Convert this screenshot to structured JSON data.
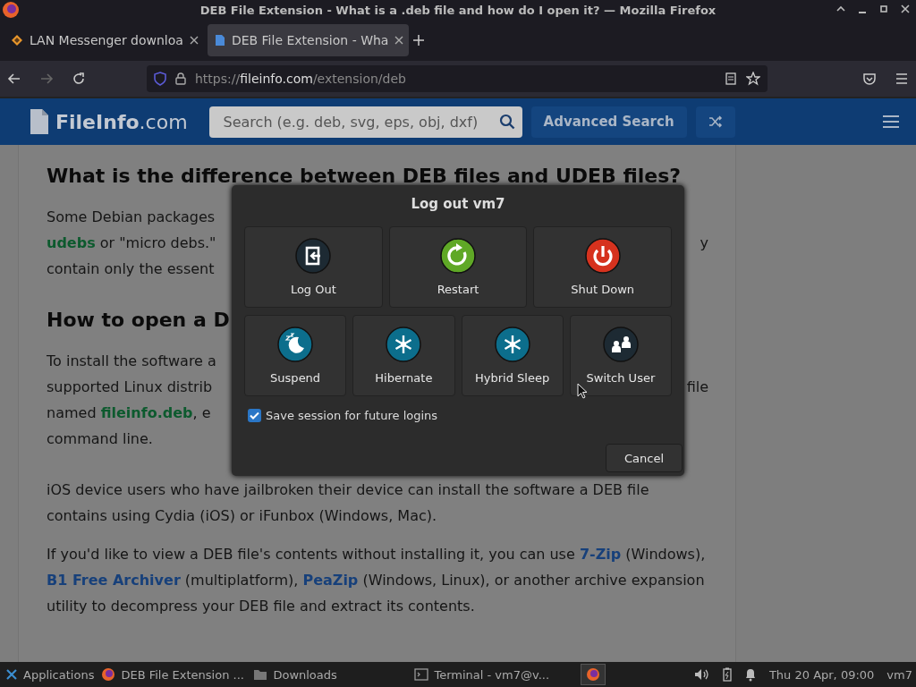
{
  "window": {
    "title": "DEB File Extension - What is a .deb file and how do I open it? — Mozilla Firefox"
  },
  "tabs": [
    {
      "label": "LAN Messenger downloa",
      "kind": "diamond",
      "selected": false
    },
    {
      "label": "DEB File Extension - Wha",
      "kind": "page",
      "selected": true
    }
  ],
  "address_bar": {
    "scheme": "https://",
    "host": "fileinfo.com",
    "path": "/extension/deb"
  },
  "site_header": {
    "logo_name": "FileInfo",
    "logo_suffix": ".com",
    "search_placeholder": "Search (e.g. deb, svg, eps, obj, dxf)",
    "advanced_search": "Advanced Search"
  },
  "article": [
    {
      "kind": "heading",
      "text": "What is the difference between DEB files and UDEB files?"
    },
    {
      "kind": "lines",
      "lines": [
        {
          "left": [
            {
              "kind": "text",
              "text": "Some Debian packages"
            }
          ]
        },
        {
          "left": [
            {
              "kind": "term",
              "text": "udebs"
            },
            {
              "kind": "text",
              "text": " or \"micro debs.\""
            }
          ],
          "right": "y"
        },
        {
          "left": [
            {
              "kind": "text",
              "text": "contain only the essent"
            }
          ]
        }
      ]
    },
    {
      "kind": "heading",
      "text": "How to open a D"
    },
    {
      "kind": "lines",
      "lines": [
        {
          "left": [
            {
              "kind": "text",
              "text": "To install the software a"
            }
          ]
        },
        {
          "left": [
            {
              "kind": "text",
              "text": "supported Linux distrib"
            }
          ],
          "right": "file"
        },
        {
          "left": [
            {
              "kind": "text",
              "text": "named "
            },
            {
              "kind": "term",
              "text": "fileinfo.deb"
            },
            {
              "kind": "text",
              "text": ", e"
            }
          ]
        },
        {
          "left": [
            {
              "kind": "text",
              "text": "command line."
            }
          ]
        }
      ]
    },
    {
      "kind": "paragraph",
      "segments": [
        {
          "kind": "text",
          "text": "iOS device users who have jailbroken their device can install the software a DEB file contains using Cydia (iOS) or iFunbox (Windows, Mac)."
        }
      ]
    },
    {
      "kind": "paragraph",
      "segments": [
        {
          "kind": "text",
          "text": "If you'd like to view a DEB file's contents without installing it, you can use "
        },
        {
          "kind": "link",
          "text": "7-Zip"
        },
        {
          "kind": "text",
          "text": " (Windows), "
        },
        {
          "kind": "link",
          "text": "B1 Free Archiver"
        },
        {
          "kind": "text",
          "text": " (multiplatform), "
        },
        {
          "kind": "link",
          "text": "PeaZip"
        },
        {
          "kind": "text",
          "text": " (Windows, Linux), or another archive expansion utility to decompress your DEB file and extract its contents."
        }
      ]
    }
  ],
  "dialog": {
    "title": "Log out vm7",
    "primary_actions": [
      {
        "kind": "logout",
        "label": "Log Out"
      },
      {
        "kind": "restart",
        "label": "Restart"
      },
      {
        "kind": "shutdown",
        "label": "Shut Down"
      }
    ],
    "secondary_actions": [
      {
        "kind": "suspend",
        "label": "Suspend"
      },
      {
        "kind": "hibernate",
        "label": "Hibernate"
      },
      {
        "kind": "hybrid_sleep",
        "label": "Hybrid Sleep"
      },
      {
        "kind": "switch_user",
        "label": "Switch User"
      }
    ],
    "save_session": {
      "label": "Save session for future logins",
      "checked": true
    },
    "cancel": "Cancel"
  },
  "taskbar": {
    "items": [
      {
        "kind": "apps",
        "label": "Applications"
      },
      {
        "kind": "firefox",
        "label": "DEB File Extension ..."
      },
      {
        "kind": "folder",
        "label": "Downloads"
      },
      {
        "kind": "terminal",
        "label": "Terminal - vm7@v..."
      }
    ],
    "clock": "Thu 20 Apr, 09:00",
    "user": "vm7"
  }
}
